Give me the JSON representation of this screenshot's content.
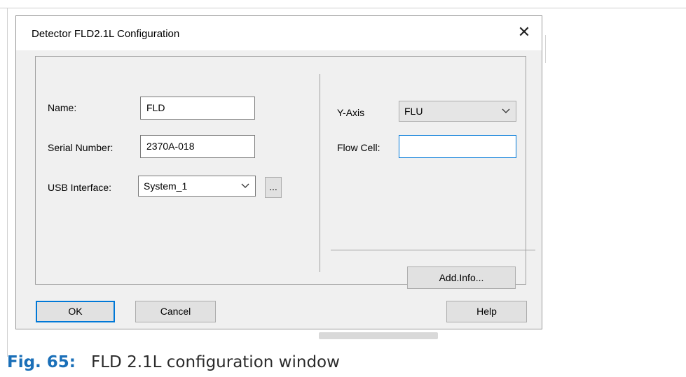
{
  "dialog": {
    "title": "Detector FLD2.1L Configuration",
    "close_icon": "close-icon"
  },
  "left": {
    "name_label": "Name:",
    "name_value": "FLD",
    "serial_label": "Serial Number:",
    "serial_value": "2370A-018",
    "usb_label": "USB Interface:",
    "usb_value": "System_1",
    "browse_label": "..."
  },
  "right": {
    "yaxis_label": "Y-Axis",
    "yaxis_value": "FLU",
    "flowcell_label": "Flow Cell:",
    "flowcell_value": "",
    "addinfo_label": "Add.Info..."
  },
  "footer": {
    "ok_label": "OK",
    "cancel_label": "Cancel",
    "help_label": "Help"
  },
  "caption": {
    "number": "Fig. 65:",
    "text": "FLD 2.1L configuration window"
  },
  "colors": {
    "accent": "#0078d7",
    "caption_number": "#1a6fb8"
  }
}
